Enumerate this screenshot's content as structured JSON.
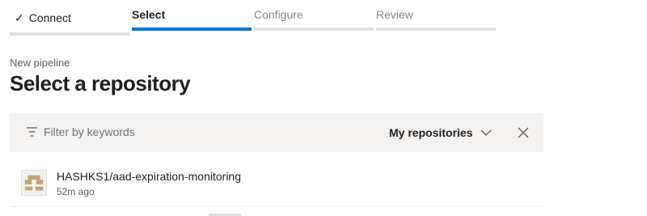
{
  "stepper": {
    "steps": [
      {
        "label": "Connect",
        "state": "done"
      },
      {
        "label": "Select",
        "state": "active"
      },
      {
        "label": "Configure",
        "state": "todo"
      },
      {
        "label": "Review",
        "state": "todo"
      }
    ]
  },
  "header": {
    "subtitle": "New pipeline",
    "title": "Select a repository"
  },
  "filter": {
    "placeholder": "Filter by keywords",
    "icon": "filter-icon",
    "scope_label": "My repositories",
    "scope_icon": "chevron-down-icon",
    "clear_icon": "close-icon"
  },
  "repositories": [
    {
      "name": "HASHKS1/aad-expiration-monitoring",
      "updated": "52m ago",
      "icon": "repo-avatar"
    }
  ],
  "colors": {
    "accent": "#0078d4",
    "avatar": "#c8a270",
    "filter_bg": "#f3f2f1"
  }
}
